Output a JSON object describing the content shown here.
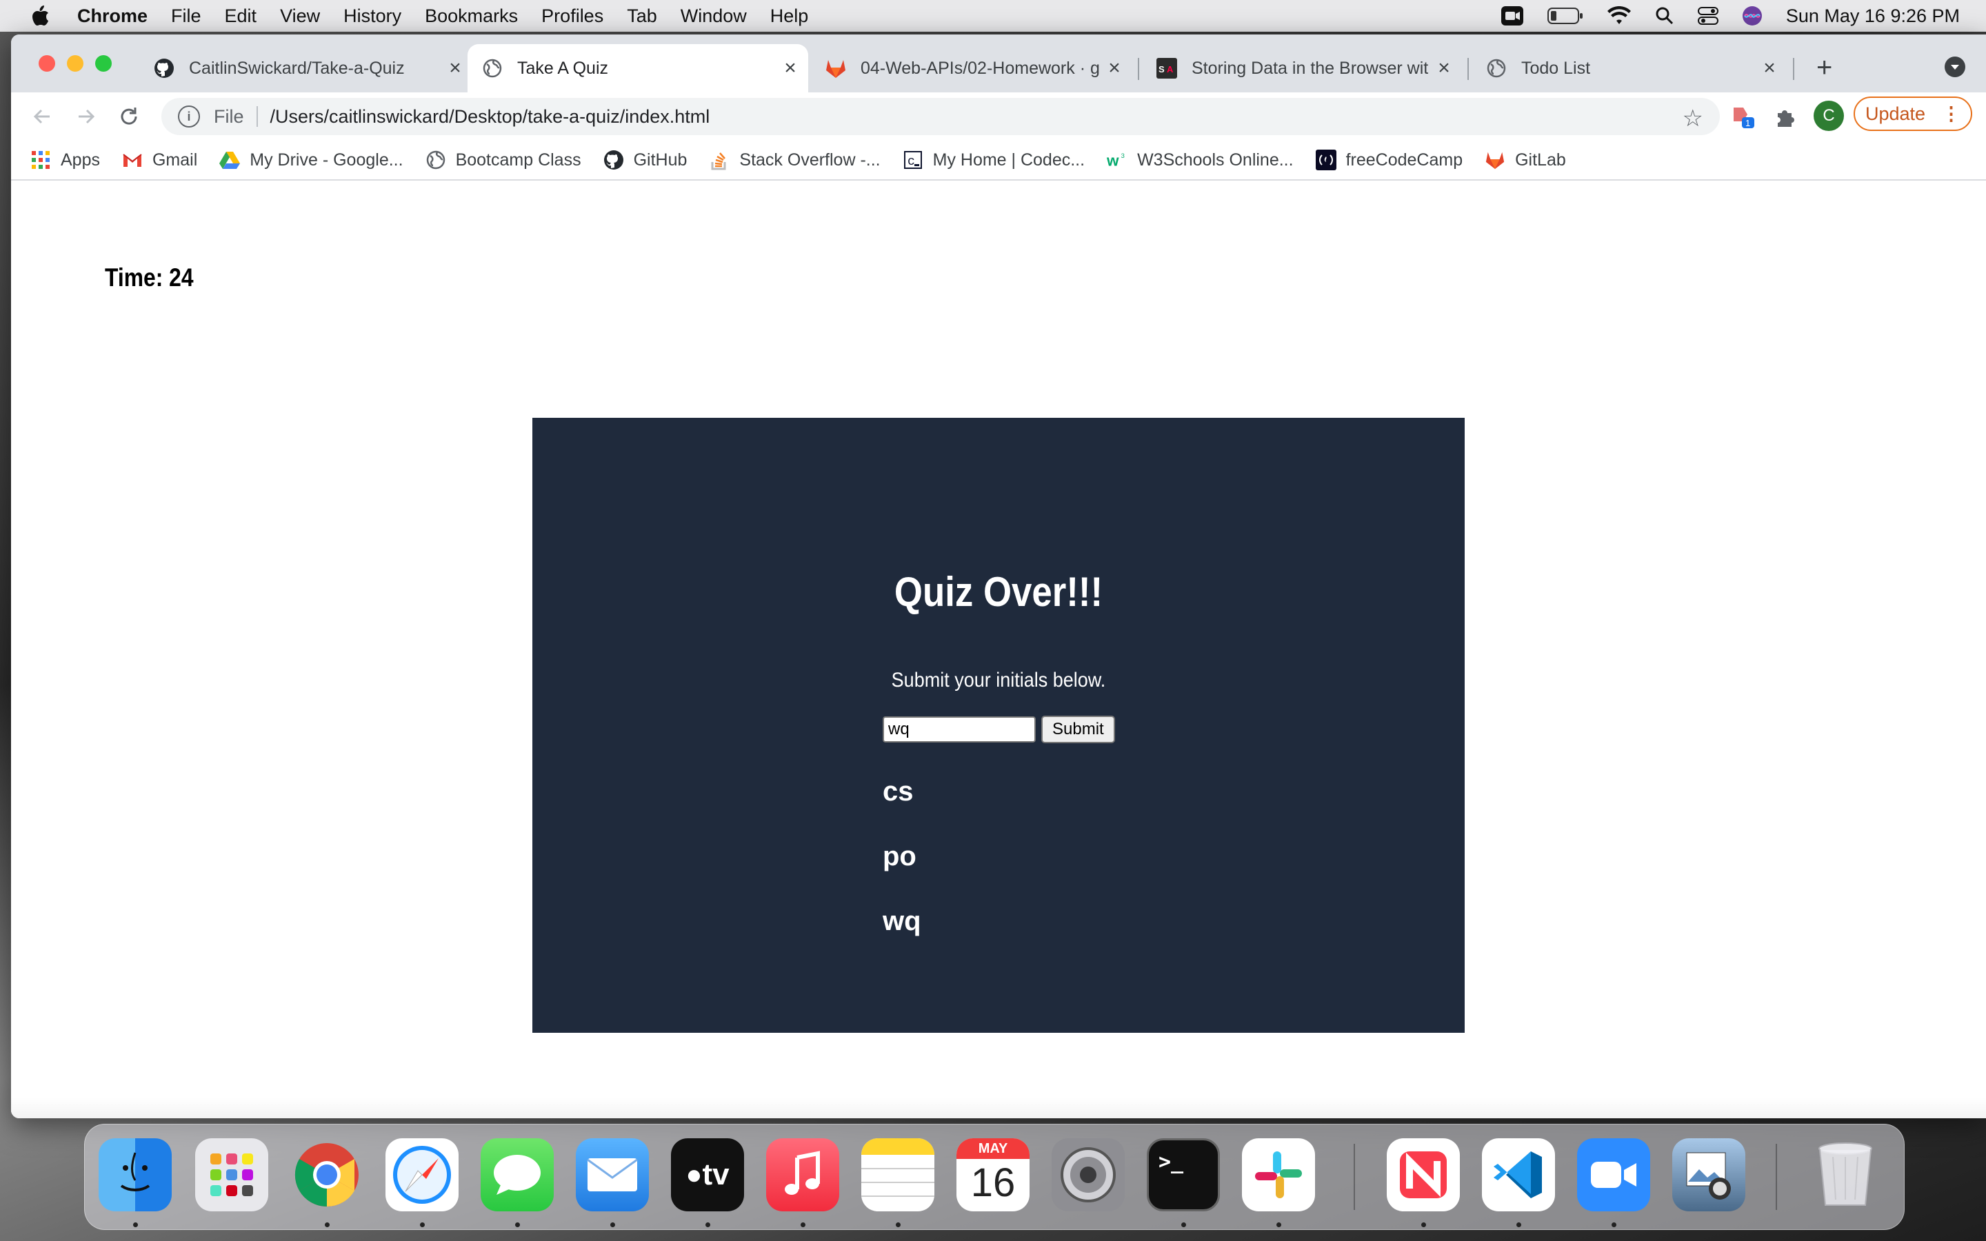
{
  "menubar": {
    "app_name": "Chrome",
    "items": [
      "File",
      "Edit",
      "View",
      "History",
      "Bookmarks",
      "Profiles",
      "Tab",
      "Window",
      "Help"
    ],
    "clock": "Sun May 16  9:26 PM"
  },
  "tabs": [
    {
      "title": "CaitlinSwickard/Take-a-Quiz",
      "icon": "github-icon",
      "active": false
    },
    {
      "title": "Take A Quiz",
      "icon": "globe-icon",
      "active": true
    },
    {
      "title": "04-Web-APIs/02-Homework · g",
      "icon": "gitlab-icon",
      "active": false
    },
    {
      "title": "Storing Data in the Browser wit",
      "icon": "sa-icon",
      "active": false
    },
    {
      "title": "Todo List",
      "icon": "globe-icon",
      "active": false
    }
  ],
  "omnibox": {
    "protocol_label": "File",
    "url": "/Users/caitlinswickard/Desktop/take-a-quiz/index.html"
  },
  "toolbar": {
    "profile_initial": "C",
    "update_label": "Update",
    "ext_badge": "1"
  },
  "bookmarks": [
    {
      "label": "Apps",
      "icon": "apps-grid-icon"
    },
    {
      "label": "Gmail",
      "icon": "gmail-icon"
    },
    {
      "label": "My Drive - Google...",
      "icon": "google-drive-icon"
    },
    {
      "label": "Bootcamp Class",
      "icon": "globe-icon"
    },
    {
      "label": "GitHub",
      "icon": "github-icon"
    },
    {
      "label": "Stack Overflow -...",
      "icon": "stackoverflow-icon"
    },
    {
      "label": "My Home | Codec...",
      "icon": "codecademy-icon"
    },
    {
      "label": "W3Schools Online...",
      "icon": "w3schools-icon"
    },
    {
      "label": "freeCodeCamp",
      "icon": "freecodecamp-icon"
    },
    {
      "label": "GitLab",
      "icon": "gitlab-icon"
    }
  ],
  "page": {
    "timer": "Time: 24",
    "heading": "Quiz Over!!!",
    "instructions": "Submit your initials below.",
    "initials_value": "wq",
    "submit_label": "Submit",
    "scores": [
      "cs",
      "po",
      "wq"
    ]
  },
  "dock": {
    "calendar_month": "MAY",
    "calendar_day": "16",
    "tv_label": "tv"
  }
}
